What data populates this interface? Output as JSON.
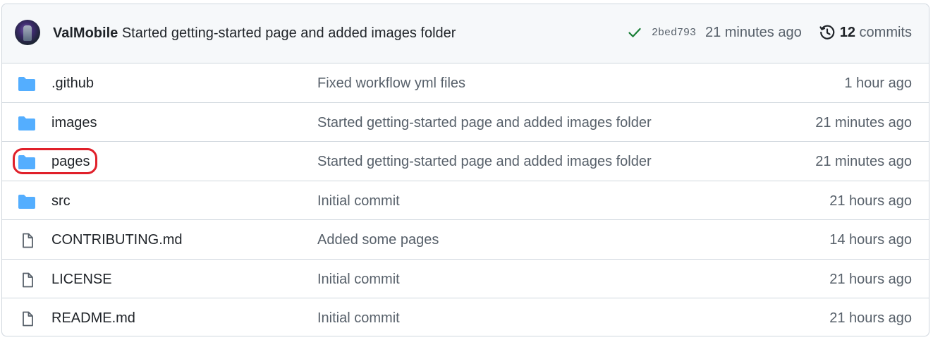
{
  "latest_commit": {
    "author": "ValMobile",
    "message": "Started getting-started page and added images folder",
    "sha": "2bed793",
    "time": "21 minutes ago",
    "commit_count": "12",
    "commits_label": "commits"
  },
  "files": [
    {
      "type": "folder",
      "name": ".github",
      "message": "Fixed workflow yml files",
      "time": "1 hour ago"
    },
    {
      "type": "folder",
      "name": "images",
      "message": "Started getting-started page and added images folder",
      "time": "21 minutes ago"
    },
    {
      "type": "folder",
      "name": "pages",
      "message": "Started getting-started page and added images folder",
      "time": "21 minutes ago"
    },
    {
      "type": "folder",
      "name": "src",
      "message": "Initial commit",
      "time": "21 hours ago"
    },
    {
      "type": "file",
      "name": "CONTRIBUTING.md",
      "message": "Added some pages",
      "time": "14 hours ago"
    },
    {
      "type": "file",
      "name": "LICENSE",
      "message": "Initial commit",
      "time": "21 hours ago"
    },
    {
      "type": "file",
      "name": "README.md",
      "message": "Initial commit",
      "time": "21 hours ago"
    }
  ],
  "colors": {
    "folder": "#54aeff",
    "success": "#1a7f37",
    "highlight": "#e0202a"
  }
}
